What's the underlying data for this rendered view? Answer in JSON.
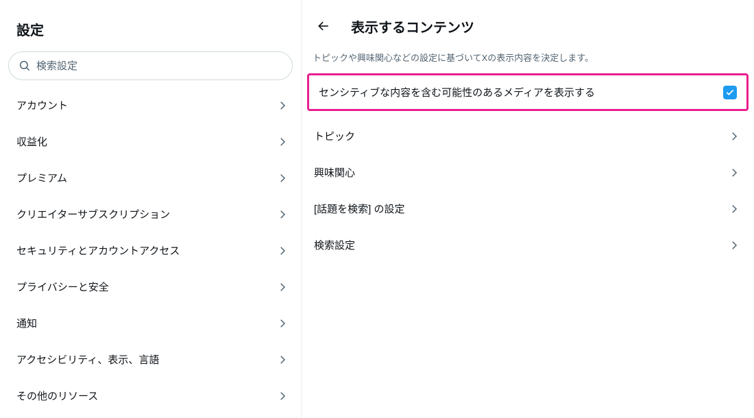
{
  "sidebar": {
    "title": "設定",
    "search_placeholder": "検索設定",
    "items": [
      {
        "label": "アカウント"
      },
      {
        "label": "収益化"
      },
      {
        "label": "プレミアム"
      },
      {
        "label": "クリエイターサブスクリプション"
      },
      {
        "label": "セキュリティとアカウントアクセス"
      },
      {
        "label": "プライバシーと安全"
      },
      {
        "label": "通知"
      },
      {
        "label": "アクセシビリティ、表示、言語"
      },
      {
        "label": "その他のリソース"
      }
    ]
  },
  "main": {
    "title": "表示するコンテンツ",
    "description": "トピックや興味関心などの設定に基づいてXの表示内容を決定します。",
    "sensitive_label": "センシティブな内容を含む可能性のあるメディアを表示する",
    "sensitive_checked": true,
    "options": [
      {
        "label": "トピック"
      },
      {
        "label": "興味関心"
      },
      {
        "label": "[話題を検索] の設定"
      },
      {
        "label": "検索設定"
      }
    ]
  }
}
